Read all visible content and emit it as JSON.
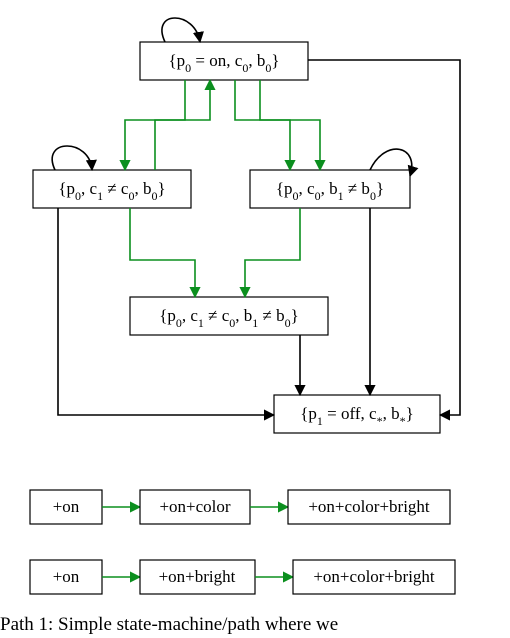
{
  "diagram": {
    "nodes": {
      "A": {
        "type": "state",
        "label_html": "{p<tspan class='sub-txt'>0</tspan> = on, c<tspan class='sub-txt'>0</tspan>, b<tspan class='sub-txt'>0</tspan>}"
      },
      "B": {
        "type": "state",
        "label_html": "{p<tspan class='sub-txt'>0</tspan>, c<tspan class='sub-txt'>1</tspan> ≠ c<tspan class='sub-txt'>0</tspan>, b<tspan class='sub-txt'>0</tspan>}"
      },
      "C": {
        "type": "state",
        "label_html": "{p<tspan class='sub-txt'>0</tspan>, c<tspan class='sub-txt'>0</tspan>, b<tspan class='sub-txt'>1</tspan> ≠ b<tspan class='sub-txt'>0</tspan>}"
      },
      "D": {
        "type": "state",
        "label_html": "{p<tspan class='sub-txt'>0</tspan>, c<tspan class='sub-txt'>1</tspan> ≠ c<tspan class='sub-txt'>0</tspan>, b<tspan class='sub-txt'>1</tspan> ≠ b<tspan class='sub-txt'>0</tspan>}"
      },
      "E": {
        "type": "state",
        "label_html": "{p<tspan class='sub-txt'>1</tspan> = off, c<tspan class='sub-txt'>*</tspan>, b<tspan class='sub-txt'>*</tspan>}"
      }
    },
    "paths": {
      "p1a": "+on",
      "p1b": "+on+color",
      "p1c": "+on+color+bright",
      "p2a": "+on",
      "p2b": "+on+bright",
      "p2c": "+on+color+bright"
    }
  },
  "caption": "Path 1: Simple state-machine/path where we"
}
